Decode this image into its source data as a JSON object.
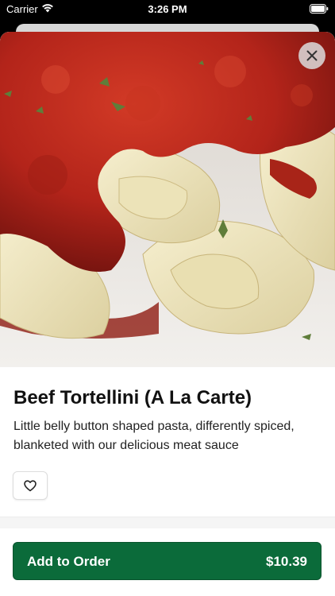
{
  "status_bar": {
    "carrier": "Carrier",
    "time": "3:26 PM"
  },
  "item": {
    "title": "Beef Tortellini (A La Carte)",
    "description": "Little belly button shaped pasta, differently spiced, blanketed with our delicious meat sauce"
  },
  "actions": {
    "add_label": "Add to Order",
    "price": "$10.39"
  },
  "icons": {
    "close": "close-icon",
    "favorite": "heart-outline-icon",
    "wifi": "wifi-icon",
    "battery": "battery-icon"
  },
  "colors": {
    "primary_button": "#0b6b3a",
    "sauce": "#b5251a",
    "pasta": "#efe6bf"
  }
}
